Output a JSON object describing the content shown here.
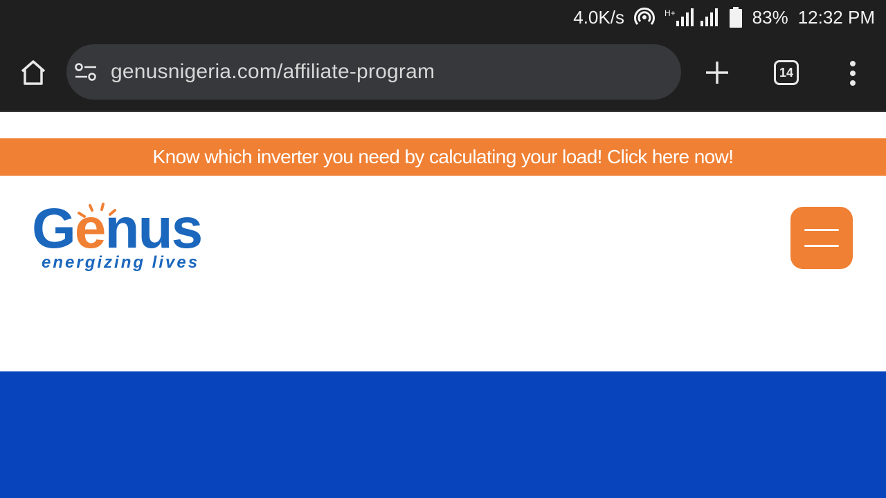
{
  "status_bar": {
    "speed": "4.0K/s",
    "battery": "83%",
    "time": "12:32 PM",
    "network_type": "H+"
  },
  "browser": {
    "url": "genusnigeria.com/affiliate-program",
    "tab_count": "14"
  },
  "promo_banner": {
    "text": "Know which inverter you need by calculating your load! Click here now!"
  },
  "logo": {
    "word_start": "G",
    "word_e": "e",
    "word_end": "nus",
    "tagline": "energizing lives"
  },
  "colors": {
    "brand_blue": "#1b67bd",
    "brand_orange": "#f08034",
    "hero_blue": "#0845bc",
    "chrome_dark": "#1f1f1f"
  }
}
